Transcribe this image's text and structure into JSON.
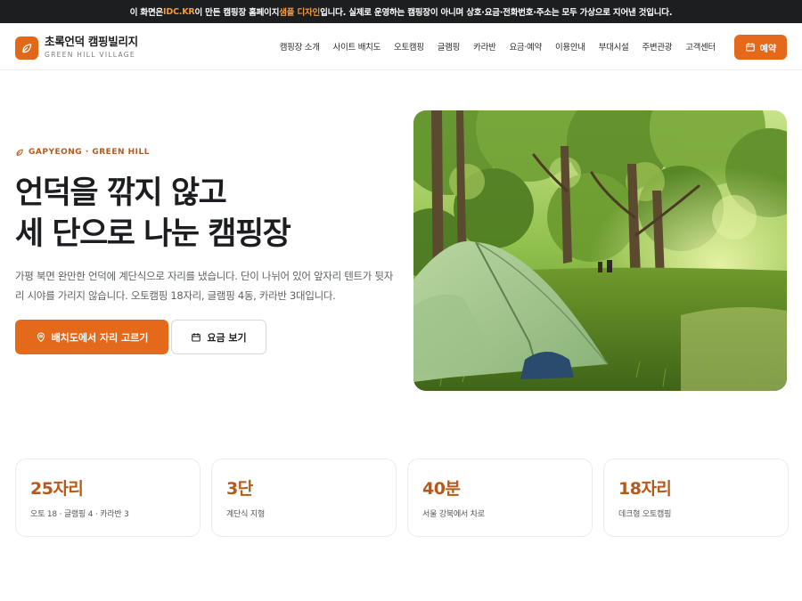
{
  "notice": {
    "part1": "이 화면은 ",
    "highlight1": "IDC.KR",
    "part2": " 이 만든 캠핑장 홈페이지 ",
    "highlight2": "샘플 디자인",
    "part3": "입니다. 실제로 운영하는 캠핑장이 아니며 상호·요금·전화번호·주소는 모두 가상으로 지어낸 것입니다."
  },
  "brand": {
    "name": "초록언덕 캠핑빌리지",
    "subtitle": "GREEN HILL VILLAGE",
    "icon": "leaf-icon"
  },
  "nav": {
    "items": [
      "캠핑장 소개",
      "사이트 배치도",
      "오토캠핑",
      "글램핑",
      "카라반",
      "요금·예약",
      "이용안내",
      "부대시설",
      "주변관광",
      "고객센터"
    ]
  },
  "reserve_button": {
    "label": "예약",
    "icon": "calendar-icon"
  },
  "hero": {
    "eyebrow": "GAPYEONG · GREEN HILL",
    "title_line1": "언덕을 깎지 않고",
    "title_line2": "세 단으로 나눈 캠핑장",
    "description": "가평 북면 완만한 언덕에 계단식으로 자리를 냈습니다. 단이 나뉘어 있어 앞자리 텐트가 뒷자리 시야를 가리지 않습니다. 오토캠핑 18자리, 글램핑 4동, 카라반 3대입니다.",
    "primary_button": "배치도에서 자리 고르기",
    "secondary_button": "요금 보기"
  },
  "stats": [
    {
      "value": "25자리",
      "label": "오토 18 · 글램핑 4 · 카라반 3"
    },
    {
      "value": "3단",
      "label": "계단식 지형"
    },
    {
      "value": "40분",
      "label": "서울 강북에서 차로"
    },
    {
      "value": "18자리",
      "label": "데크형 오토캠핑"
    }
  ],
  "colors": {
    "accent": "#e4691b",
    "accent_text": "#b75a19",
    "notice_bg": "#1d1e20",
    "notice_highlight": "#f39a3a"
  }
}
